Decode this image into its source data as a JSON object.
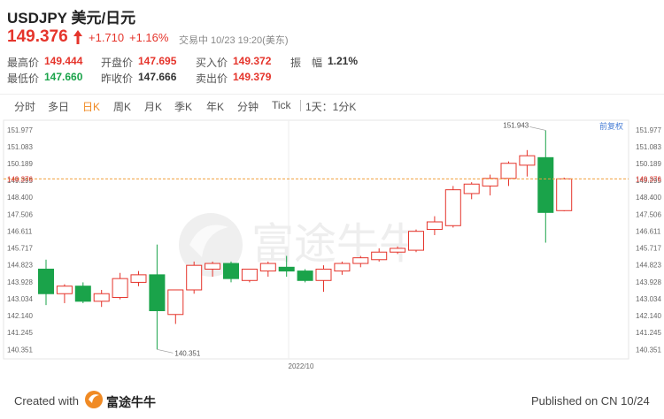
{
  "header": {
    "title": "USDJPY 美元/日元",
    "price": "149.376",
    "change": "+1.710",
    "change_pct": "+1.16%",
    "status": "交易中 10/23 19:20(美东)"
  },
  "stats": [
    {
      "label": "最高价",
      "value": "149.444",
      "color": "red"
    },
    {
      "label": "开盘价",
      "value": "147.695",
      "color": "red"
    },
    {
      "label": "买入价",
      "value": "149.372",
      "color": "red"
    },
    {
      "label": "振　幅",
      "value": "1.21%",
      "color": "dark"
    },
    {
      "label": "最低价",
      "value": "147.660",
      "color": "green"
    },
    {
      "label": "昨收价",
      "value": "147.666",
      "color": "dark"
    },
    {
      "label": "卖出价",
      "value": "149.379",
      "color": "red"
    }
  ],
  "tabs": [
    "分时",
    "多日",
    "日K",
    "周K",
    "月K",
    "季K",
    "年K",
    "分钟",
    "Tick",
    "1天：1分K"
  ],
  "active_tab": "日K",
  "fuquan_label": "前复权",
  "footer": {
    "created": "Created with",
    "brand": "富途牛牛",
    "published": "Published on CN 10/24"
  },
  "watermark": "富途牛牛",
  "colors": {
    "up": "#e5342b",
    "down": "#1aa34a",
    "accent": "#f08a24"
  },
  "chart_data": {
    "type": "candlestick",
    "y_ticks": [
      "151.977",
      "151.083",
      "150.189",
      "149.295",
      "148.400",
      "147.506",
      "146.611",
      "145.717",
      "144.823",
      "143.928",
      "143.034",
      "142.140",
      "141.245",
      "140.351"
    ],
    "ylim": [
      140.0,
      152.5
    ],
    "current_price_label": "149.376",
    "x_label": "2022/10",
    "annotations": {
      "high": "151.943",
      "low": "140.351"
    },
    "candles": [
      {
        "o": 144.6,
        "h": 145.1,
        "l": 142.7,
        "c": 143.3
      },
      {
        "o": 143.3,
        "h": 143.8,
        "l": 142.8,
        "c": 143.7
      },
      {
        "o": 143.7,
        "h": 143.9,
        "l": 142.8,
        "c": 142.9
      },
      {
        "o": 142.9,
        "h": 143.5,
        "l": 142.6,
        "c": 143.3
      },
      {
        "o": 143.1,
        "h": 144.4,
        "l": 143.0,
        "c": 144.1
      },
      {
        "o": 143.9,
        "h": 144.5,
        "l": 143.7,
        "c": 144.3
      },
      {
        "o": 144.3,
        "h": 145.9,
        "l": 140.351,
        "c": 142.4
      },
      {
        "o": 142.2,
        "h": 143.5,
        "l": 141.7,
        "c": 143.5
      },
      {
        "o": 143.5,
        "h": 145.0,
        "l": 143.3,
        "c": 144.8
      },
      {
        "o": 144.6,
        "h": 145.0,
        "l": 144.2,
        "c": 144.9
      },
      {
        "o": 144.9,
        "h": 145.0,
        "l": 143.9,
        "c": 144.1
      },
      {
        "o": 144.0,
        "h": 144.6,
        "l": 143.9,
        "c": 144.6
      },
      {
        "o": 144.5,
        "h": 145.0,
        "l": 144.2,
        "c": 144.9
      },
      {
        "o": 144.7,
        "h": 145.3,
        "l": 144.2,
        "c": 144.5
      },
      {
        "o": 144.5,
        "h": 144.6,
        "l": 143.9,
        "c": 144.0
      },
      {
        "o": 144.0,
        "h": 144.8,
        "l": 143.4,
        "c": 144.6
      },
      {
        "o": 144.5,
        "h": 145.0,
        "l": 144.3,
        "c": 144.9
      },
      {
        "o": 144.9,
        "h": 145.3,
        "l": 144.7,
        "c": 145.2
      },
      {
        "o": 145.1,
        "h": 145.7,
        "l": 145.0,
        "c": 145.5
      },
      {
        "o": 145.5,
        "h": 145.8,
        "l": 145.4,
        "c": 145.7
      },
      {
        "o": 145.6,
        "h": 146.7,
        "l": 145.5,
        "c": 146.6
      },
      {
        "o": 146.7,
        "h": 147.4,
        "l": 146.4,
        "c": 147.1
      },
      {
        "o": 146.9,
        "h": 149.0,
        "l": 146.8,
        "c": 148.8
      },
      {
        "o": 148.6,
        "h": 149.2,
        "l": 148.3,
        "c": 149.1
      },
      {
        "o": 149.0,
        "h": 149.6,
        "l": 148.5,
        "c": 149.4
      },
      {
        "o": 149.4,
        "h": 150.3,
        "l": 149.0,
        "c": 150.2
      },
      {
        "o": 150.1,
        "h": 150.9,
        "l": 149.5,
        "c": 150.6
      },
      {
        "o": 150.5,
        "h": 151.943,
        "l": 146.0,
        "c": 147.6
      },
      {
        "o": 147.695,
        "h": 149.444,
        "l": 147.66,
        "c": 149.376
      }
    ]
  }
}
